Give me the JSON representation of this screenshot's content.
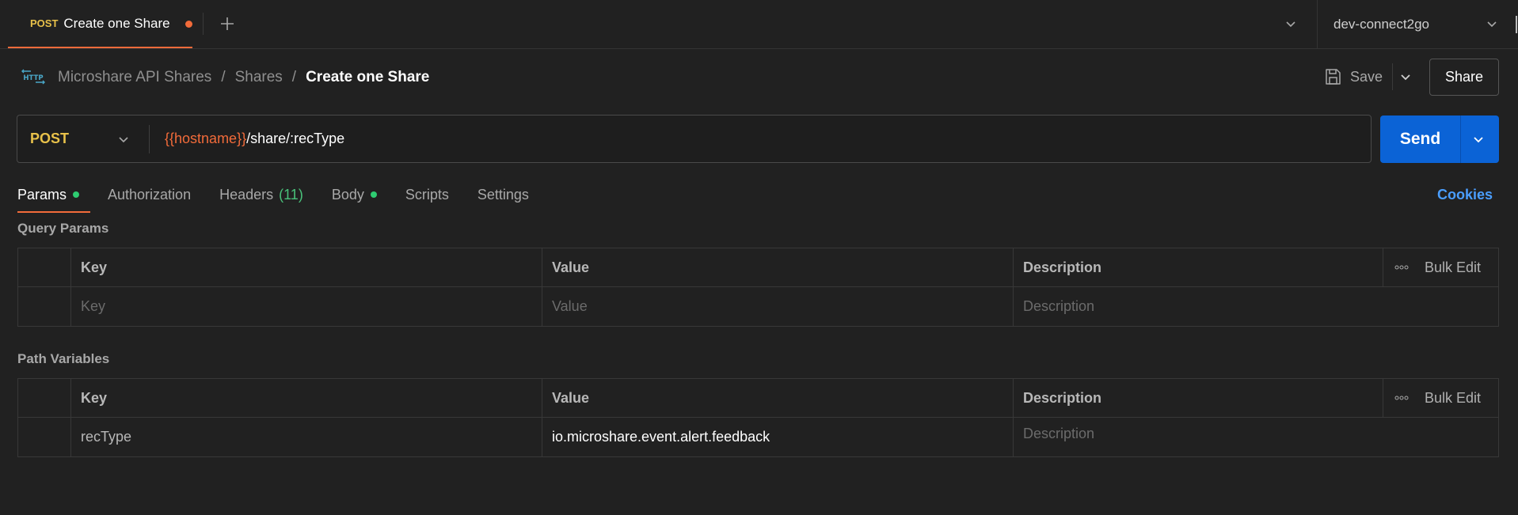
{
  "tab": {
    "method": "POST",
    "title": "Create one Share"
  },
  "environment": {
    "name": "dev-connect2go"
  },
  "breadcrumb": {
    "collection": "Microshare API Shares",
    "folder": "Shares",
    "current": "Create one Share",
    "separator": "/"
  },
  "toolbar": {
    "save_label": "Save",
    "share_label": "Share"
  },
  "request": {
    "method": "POST",
    "url_variable": "{{hostname}}",
    "url_path": "/share/:recType",
    "send_label": "Send"
  },
  "request_tabs": [
    {
      "label": "Params",
      "indicator": true,
      "count": ""
    },
    {
      "label": "Authorization",
      "indicator": false,
      "count": ""
    },
    {
      "label": "Headers",
      "indicator": false,
      "count": "(11)"
    },
    {
      "label": "Body",
      "indicator": true,
      "count": ""
    },
    {
      "label": "Scripts",
      "indicator": false,
      "count": ""
    },
    {
      "label": "Settings",
      "indicator": false,
      "count": ""
    }
  ],
  "cookies_label": "Cookies",
  "query_params": {
    "title": "Query Params",
    "headers": {
      "key": "Key",
      "value": "Value",
      "description": "Description",
      "bulk_edit": "Bulk Edit"
    },
    "row": {
      "key_placeholder": "Key",
      "value_placeholder": "Value",
      "description_placeholder": "Description"
    }
  },
  "path_variables": {
    "title": "Path Variables",
    "headers": {
      "key": "Key",
      "value": "Value",
      "description": "Description",
      "bulk_edit": "Bulk Edit"
    },
    "row": {
      "key": "recType",
      "value": "io.microshare.event.alert.feedback",
      "description_placeholder": "Description"
    }
  },
  "colors": {
    "accent_orange": "#f26b3a",
    "method_yellow": "#e8c14a",
    "send_blue": "#0b63d6",
    "link_blue": "#4a9eff",
    "indicator_green": "#2ecc71"
  },
  "icons": [
    "plus-icon",
    "chevron-down-icon",
    "http-icon",
    "save-icon",
    "more-icon"
  ]
}
